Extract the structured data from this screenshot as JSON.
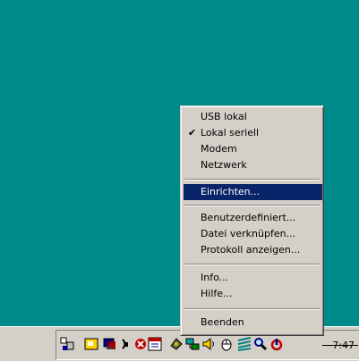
{
  "colors": {
    "desktop": "#008b8b",
    "menu": "#d4d0c8",
    "highlight": "#0a246a"
  },
  "menu": {
    "items": [
      {
        "label": "USB lokal"
      },
      {
        "label": "Lokal seriell",
        "checked": true
      },
      {
        "label": "Modem"
      },
      {
        "label": "Netzwerk"
      },
      {
        "label": "Einrichten...",
        "selected": true
      },
      {
        "label": "Benutzerdefiniert..."
      },
      {
        "label": "Datei verknüpfen..."
      },
      {
        "label": "Protokoll anzeigen..."
      },
      {
        "label": "Info..."
      },
      {
        "label": "Hilfe..."
      },
      {
        "label": "Beenden"
      }
    ],
    "check_glyph": "✔"
  },
  "tray": {
    "icons": [
      "network-wizard-icon",
      "sticky-note-icon",
      "monitor-icon",
      "antenna-icon",
      "close-red-icon",
      "calendar-icon",
      "phone-icon",
      "network-icon",
      "speaker-icon",
      "mouse-icon",
      "stripes-icon",
      "magnifier-icon",
      "power-icon"
    ],
    "clock": "7:47"
  }
}
